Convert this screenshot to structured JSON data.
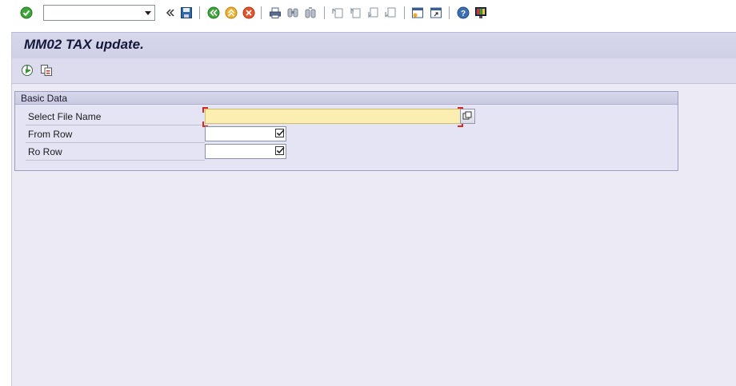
{
  "toolbar": {
    "command_field": {
      "value": "",
      "placeholder": ""
    },
    "icons": [
      "enter-icon",
      "command-dropdown-icon",
      "collapse-icon",
      "save-icon",
      "back-icon",
      "exit-icon",
      "cancel-icon",
      "print-icon",
      "find-icon",
      "find-next-icon",
      "first-page-icon",
      "previous-page-icon",
      "next-page-icon",
      "last-page-icon",
      "new-session-icon",
      "create-shortcut-icon",
      "help-icon",
      "customize-layout-icon"
    ]
  },
  "page": {
    "title": "MM02 TAX update."
  },
  "app_toolbar": {
    "icons": [
      "execute-icon",
      "get-variant-icon"
    ]
  },
  "basic_data": {
    "title": "Basic Data",
    "fields": [
      {
        "label": "Select File Name",
        "value": ""
      },
      {
        "label": "From Row",
        "value": ""
      },
      {
        "label": "Ro Row",
        "value": ""
      }
    ]
  },
  "colors": {
    "title_bar": "#d4d4ea",
    "work_area": "#ecebf5",
    "required_field": "#fbeeb0",
    "required_marker": "#d8281f",
    "title_text": "#14183a"
  }
}
